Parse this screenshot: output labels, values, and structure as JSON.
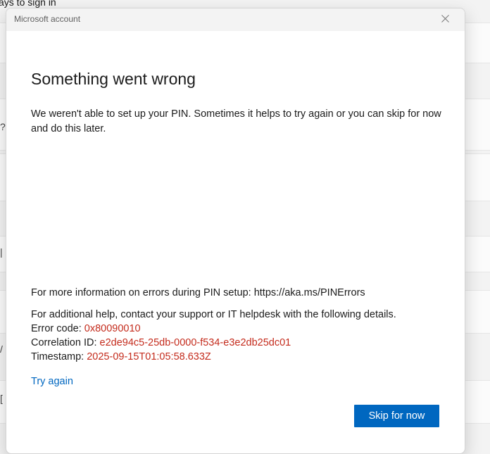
{
  "background": {
    "heading": "ays to sign in"
  },
  "dialog": {
    "window_title": "Microsoft account",
    "heading": "Something went wrong",
    "description": "We weren't able to set up your PIN. Sometimes it helps to try again or you can skip for now and do this later.",
    "more_info": "For more information on errors during PIN setup: https://aka.ms/PINErrors",
    "help_intro": "For additional help, contact your support or IT helpdesk with the following details.",
    "error_code_label": "Error code:",
    "error_code_value": "0x80090010",
    "correlation_label": "Correlation ID:",
    "correlation_value": "e2de94c5-25db-0000-f534-e3e2db25dc01",
    "timestamp_label": "Timestamp:",
    "timestamp_value": "2025-09-15T01:05:58.633Z",
    "try_again_link": "Try again",
    "skip_button": "Skip for now",
    "close_icon": "close-icon"
  },
  "colors": {
    "accent": "#0067c0",
    "error_text": "#c42b1c"
  }
}
